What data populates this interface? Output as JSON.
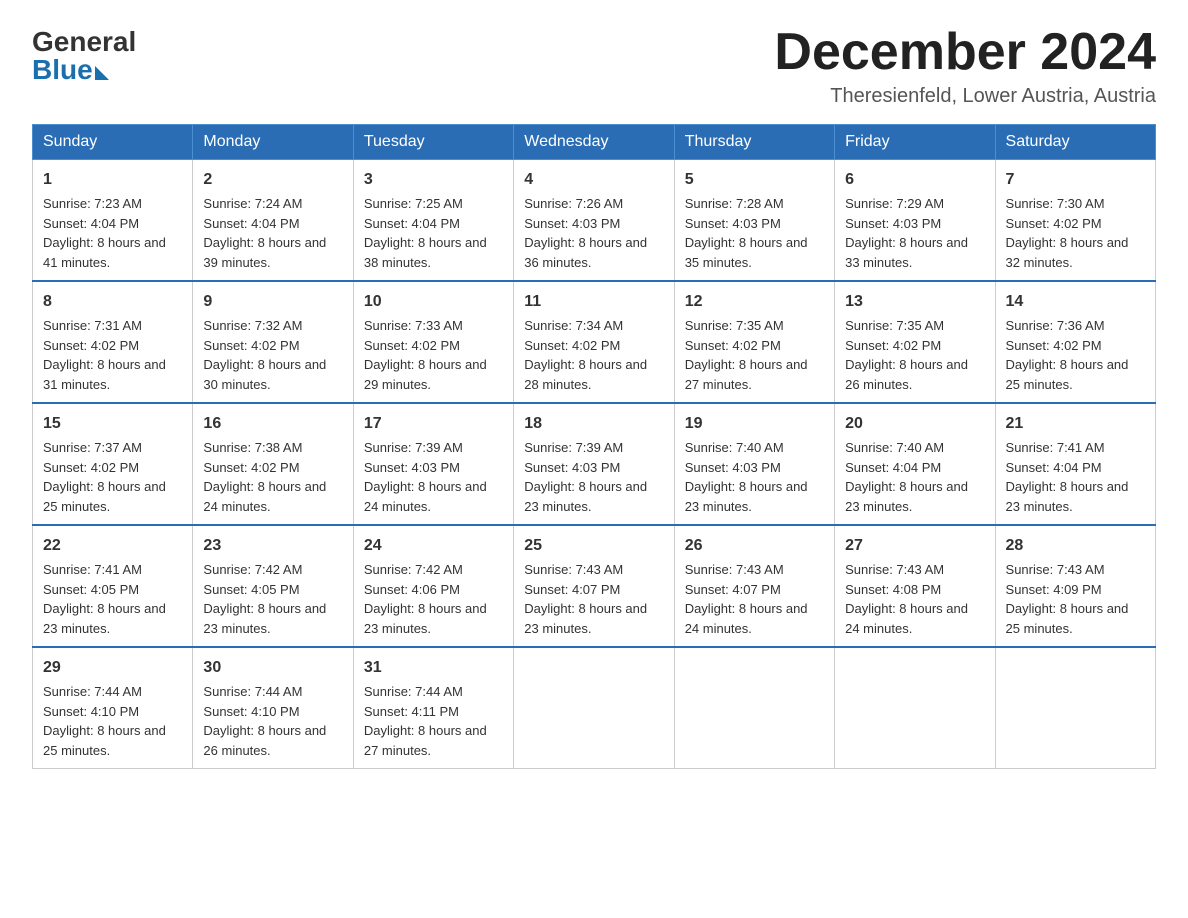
{
  "logo": {
    "general": "General",
    "blue": "Blue"
  },
  "title": "December 2024",
  "location": "Theresienfeld, Lower Austria, Austria",
  "weekdays": [
    "Sunday",
    "Monday",
    "Tuesday",
    "Wednesday",
    "Thursday",
    "Friday",
    "Saturday"
  ],
  "weeks": [
    [
      {
        "num": "1",
        "sunrise": "7:23 AM",
        "sunset": "4:04 PM",
        "daylight": "8 hours and 41 minutes."
      },
      {
        "num": "2",
        "sunrise": "7:24 AM",
        "sunset": "4:04 PM",
        "daylight": "8 hours and 39 minutes."
      },
      {
        "num": "3",
        "sunrise": "7:25 AM",
        "sunset": "4:04 PM",
        "daylight": "8 hours and 38 minutes."
      },
      {
        "num": "4",
        "sunrise": "7:26 AM",
        "sunset": "4:03 PM",
        "daylight": "8 hours and 36 minutes."
      },
      {
        "num": "5",
        "sunrise": "7:28 AM",
        "sunset": "4:03 PM",
        "daylight": "8 hours and 35 minutes."
      },
      {
        "num": "6",
        "sunrise": "7:29 AM",
        "sunset": "4:03 PM",
        "daylight": "8 hours and 33 minutes."
      },
      {
        "num": "7",
        "sunrise": "7:30 AM",
        "sunset": "4:02 PM",
        "daylight": "8 hours and 32 minutes."
      }
    ],
    [
      {
        "num": "8",
        "sunrise": "7:31 AM",
        "sunset": "4:02 PM",
        "daylight": "8 hours and 31 minutes."
      },
      {
        "num": "9",
        "sunrise": "7:32 AM",
        "sunset": "4:02 PM",
        "daylight": "8 hours and 30 minutes."
      },
      {
        "num": "10",
        "sunrise": "7:33 AM",
        "sunset": "4:02 PM",
        "daylight": "8 hours and 29 minutes."
      },
      {
        "num": "11",
        "sunrise": "7:34 AM",
        "sunset": "4:02 PM",
        "daylight": "8 hours and 28 minutes."
      },
      {
        "num": "12",
        "sunrise": "7:35 AM",
        "sunset": "4:02 PM",
        "daylight": "8 hours and 27 minutes."
      },
      {
        "num": "13",
        "sunrise": "7:35 AM",
        "sunset": "4:02 PM",
        "daylight": "8 hours and 26 minutes."
      },
      {
        "num": "14",
        "sunrise": "7:36 AM",
        "sunset": "4:02 PM",
        "daylight": "8 hours and 25 minutes."
      }
    ],
    [
      {
        "num": "15",
        "sunrise": "7:37 AM",
        "sunset": "4:02 PM",
        "daylight": "8 hours and 25 minutes."
      },
      {
        "num": "16",
        "sunrise": "7:38 AM",
        "sunset": "4:02 PM",
        "daylight": "8 hours and 24 minutes."
      },
      {
        "num": "17",
        "sunrise": "7:39 AM",
        "sunset": "4:03 PM",
        "daylight": "8 hours and 24 minutes."
      },
      {
        "num": "18",
        "sunrise": "7:39 AM",
        "sunset": "4:03 PM",
        "daylight": "8 hours and 23 minutes."
      },
      {
        "num": "19",
        "sunrise": "7:40 AM",
        "sunset": "4:03 PM",
        "daylight": "8 hours and 23 minutes."
      },
      {
        "num": "20",
        "sunrise": "7:40 AM",
        "sunset": "4:04 PM",
        "daylight": "8 hours and 23 minutes."
      },
      {
        "num": "21",
        "sunrise": "7:41 AM",
        "sunset": "4:04 PM",
        "daylight": "8 hours and 23 minutes."
      }
    ],
    [
      {
        "num": "22",
        "sunrise": "7:41 AM",
        "sunset": "4:05 PM",
        "daylight": "8 hours and 23 minutes."
      },
      {
        "num": "23",
        "sunrise": "7:42 AM",
        "sunset": "4:05 PM",
        "daylight": "8 hours and 23 minutes."
      },
      {
        "num": "24",
        "sunrise": "7:42 AM",
        "sunset": "4:06 PM",
        "daylight": "8 hours and 23 minutes."
      },
      {
        "num": "25",
        "sunrise": "7:43 AM",
        "sunset": "4:07 PM",
        "daylight": "8 hours and 23 minutes."
      },
      {
        "num": "26",
        "sunrise": "7:43 AM",
        "sunset": "4:07 PM",
        "daylight": "8 hours and 24 minutes."
      },
      {
        "num": "27",
        "sunrise": "7:43 AM",
        "sunset": "4:08 PM",
        "daylight": "8 hours and 24 minutes."
      },
      {
        "num": "28",
        "sunrise": "7:43 AM",
        "sunset": "4:09 PM",
        "daylight": "8 hours and 25 minutes."
      }
    ],
    [
      {
        "num": "29",
        "sunrise": "7:44 AM",
        "sunset": "4:10 PM",
        "daylight": "8 hours and 25 minutes."
      },
      {
        "num": "30",
        "sunrise": "7:44 AM",
        "sunset": "4:10 PM",
        "daylight": "8 hours and 26 minutes."
      },
      {
        "num": "31",
        "sunrise": "7:44 AM",
        "sunset": "4:11 PM",
        "daylight": "8 hours and 27 minutes."
      },
      null,
      null,
      null,
      null
    ]
  ]
}
